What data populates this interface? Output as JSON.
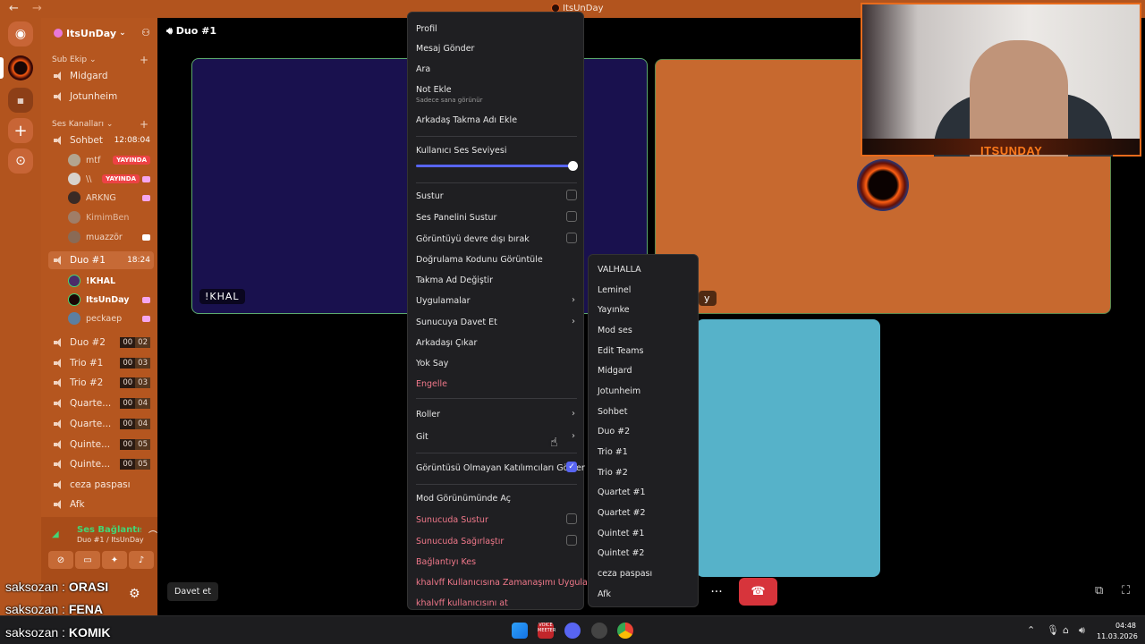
{
  "window": {
    "title": "ItsUnDay"
  },
  "server": {
    "name": "ItsUnDay"
  },
  "sidebar": {
    "categories": [
      {
        "label": "Sub Ekip"
      },
      {
        "label": "Ses Kanalları"
      }
    ],
    "channels": [
      {
        "label": "Midgard"
      },
      {
        "label": "Jotunheim"
      },
      {
        "label": "Sohbet",
        "time": "12:08:04"
      },
      {
        "label": "Duo #1",
        "time": "18:24"
      },
      {
        "label": "Duo #2",
        "count_a": "00",
        "count_b": "02"
      },
      {
        "label": "Trio #1",
        "count_a": "00",
        "count_b": "03"
      },
      {
        "label": "Trio #2",
        "count_a": "00",
        "count_b": "03"
      },
      {
        "label": "Quarte...",
        "count_a": "00",
        "count_b": "04"
      },
      {
        "label": "Quarte...",
        "count_a": "00",
        "count_b": "04"
      },
      {
        "label": "Quinte...",
        "count_a": "00",
        "count_b": "05"
      },
      {
        "label": "Quinte...",
        "count_a": "00",
        "count_b": "05"
      },
      {
        "label": "ceza paspası"
      },
      {
        "label": "Afk"
      }
    ],
    "sohbet_users": [
      {
        "name": "mtf",
        "badge": "YAYINDA"
      },
      {
        "name": "\\\\",
        "badge": "YAYINDA"
      },
      {
        "name": "ARKNG"
      },
      {
        "name": "KimimBen"
      },
      {
        "name": "muazzör"
      }
    ],
    "duo_users": [
      {
        "name": "!KHAL"
      },
      {
        "name": "ItsUnDay"
      },
      {
        "name": "peckaep"
      }
    ]
  },
  "voice_panel": {
    "status": "Ses Bağlantısı K",
    "location": "Duo #1 / ItsUnDay"
  },
  "overlay_chat": [
    {
      "user": "saksozan",
      "sep": ":",
      "msg": "ORASI"
    },
    {
      "user": "saksozan",
      "sep": ":",
      "msg": "FENA"
    },
    {
      "user": "saksozan",
      "sep": ":",
      "msg": "KOMIK"
    }
  ],
  "stage": {
    "channel": "Duo #1",
    "tile_khal_label": "!KHAL",
    "tile_its_label_fragment": "y",
    "invite_label": "Davet et",
    "more_label": "···"
  },
  "webcam": {
    "label": "ITSUNDAY"
  },
  "context_menu": {
    "profile": "Profil",
    "message": "Mesaj Gönder",
    "call": "Ara",
    "add_note": "Not Ekle",
    "add_note_sub": "Sadece sana görünür",
    "add_nickname": "Arkadaş Takma Adı Ekle",
    "volume_label": "Kullanıcı Ses Seviyesi",
    "volume_level": 1.0,
    "mute": "Sustur",
    "mute_soundboard": "Ses Panelini Sustur",
    "disable_video": "Görüntüyü devre dışı bırak",
    "view_verification": "Doğrulama Kodunu Görüntüle",
    "change_nickname": "Takma Ad Değiştir",
    "apps": "Uygulamalar",
    "invite_to_server": "Sunucuya Davet Et",
    "remove_friend": "Arkadaşı Çıkar",
    "ignore": "Yok Say",
    "block": "Engelle",
    "roles": "Roller",
    "move": "Git",
    "show_non_video": "Görüntüsü Olmayan Katılımcıları Göster",
    "show_non_video_checked": true,
    "mod_view": "Mod Görünümünde Aç",
    "server_mute": "Sunucuda Sustur",
    "server_deafen": "Sunucuda Sağırlaştır",
    "disconnect": "Bağlantıyı Kes",
    "timeout": "khalvff Kullanıcısına Zamanaşımı Uygula",
    "kick": "khalvff kullanıcısını at"
  },
  "move_submenu": [
    "VALHALLA",
    "Leminel",
    "Yayınke",
    "Mod ses",
    "Edit Teams",
    "Midgard",
    "Jotunheim",
    "Sohbet",
    "Duo #2",
    "Trio #1",
    "Trio #2",
    "Quartet #1",
    "Quartet #2",
    "Quintet #1",
    "Quintet #2",
    "ceza paspası",
    "Afk"
  ],
  "taskbar": {
    "time": "04:48",
    "date": "11.03.2026",
    "voice_app_label": "VOICE MEETER"
  },
  "colors": {
    "accent_orange": "#b2541e",
    "discord_blurple": "#5865f2",
    "live_red": "#ed4245",
    "hangup_red": "#d7343b",
    "danger_text": "#f0788a"
  }
}
